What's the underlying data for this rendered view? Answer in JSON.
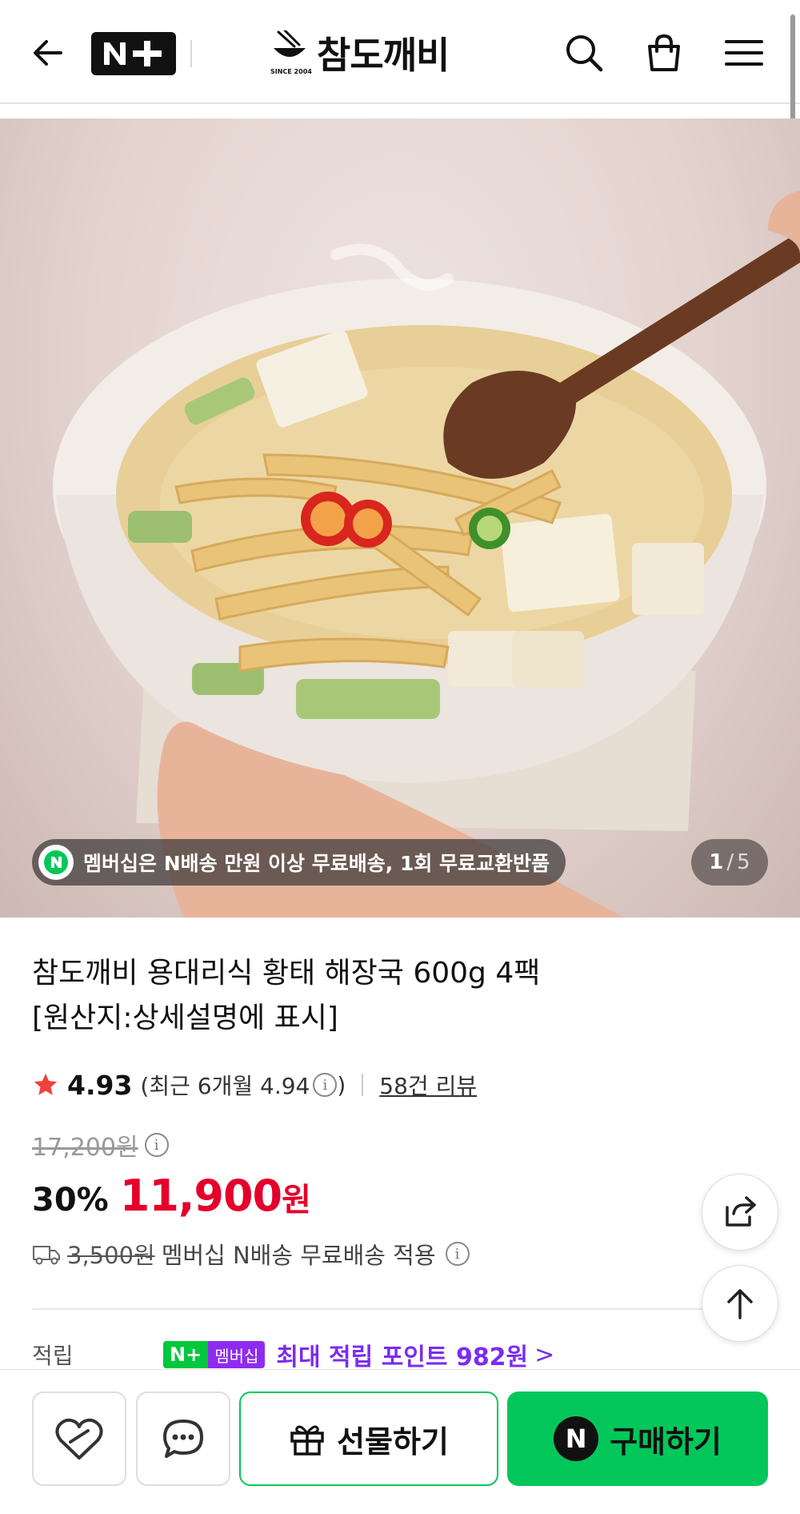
{
  "header": {
    "brand_name": "참도깨비",
    "brand_since": "SINCE 2004",
    "nplus_text": "N+"
  },
  "hero": {
    "membership_notice": "멤버십은 N배송 만원 이상 무료배송, 1회 무료교환반품",
    "n_badge": "N",
    "page_current": "1",
    "page_sep": "/",
    "page_total": "5"
  },
  "product": {
    "title_line1": "참도깨비 용대리식 황태 해장국 600g 4팩",
    "title_line2": "[원산지:상세설명에 표시]",
    "rating": "4.93",
    "recent_rating_prefix": "(최근 6개월 4.94",
    "recent_rating_suffix": ")",
    "review_count": "58건 리뷰",
    "original_price": "17,200원",
    "discount_pct": "30%",
    "sale_price": "11,900",
    "sale_unit": "원",
    "shipping_fee": "3,500원",
    "shipping_note": "멤버십 N배송 무료배송 적용",
    "points_label": "적립",
    "points_chip_n": "N+",
    "points_chip_member": "멤버십",
    "points_text": "최대 적립 포인트 982원",
    "points_chevron": ">"
  },
  "actions": {
    "gift_label": "선물하기",
    "buy_label": "구매하기",
    "buy_n": "N"
  },
  "colors": {
    "sale_red": "#e4002b",
    "naver_green": "#03c75a",
    "points_purple": "#7b2cf0",
    "star": "#f0423c"
  }
}
